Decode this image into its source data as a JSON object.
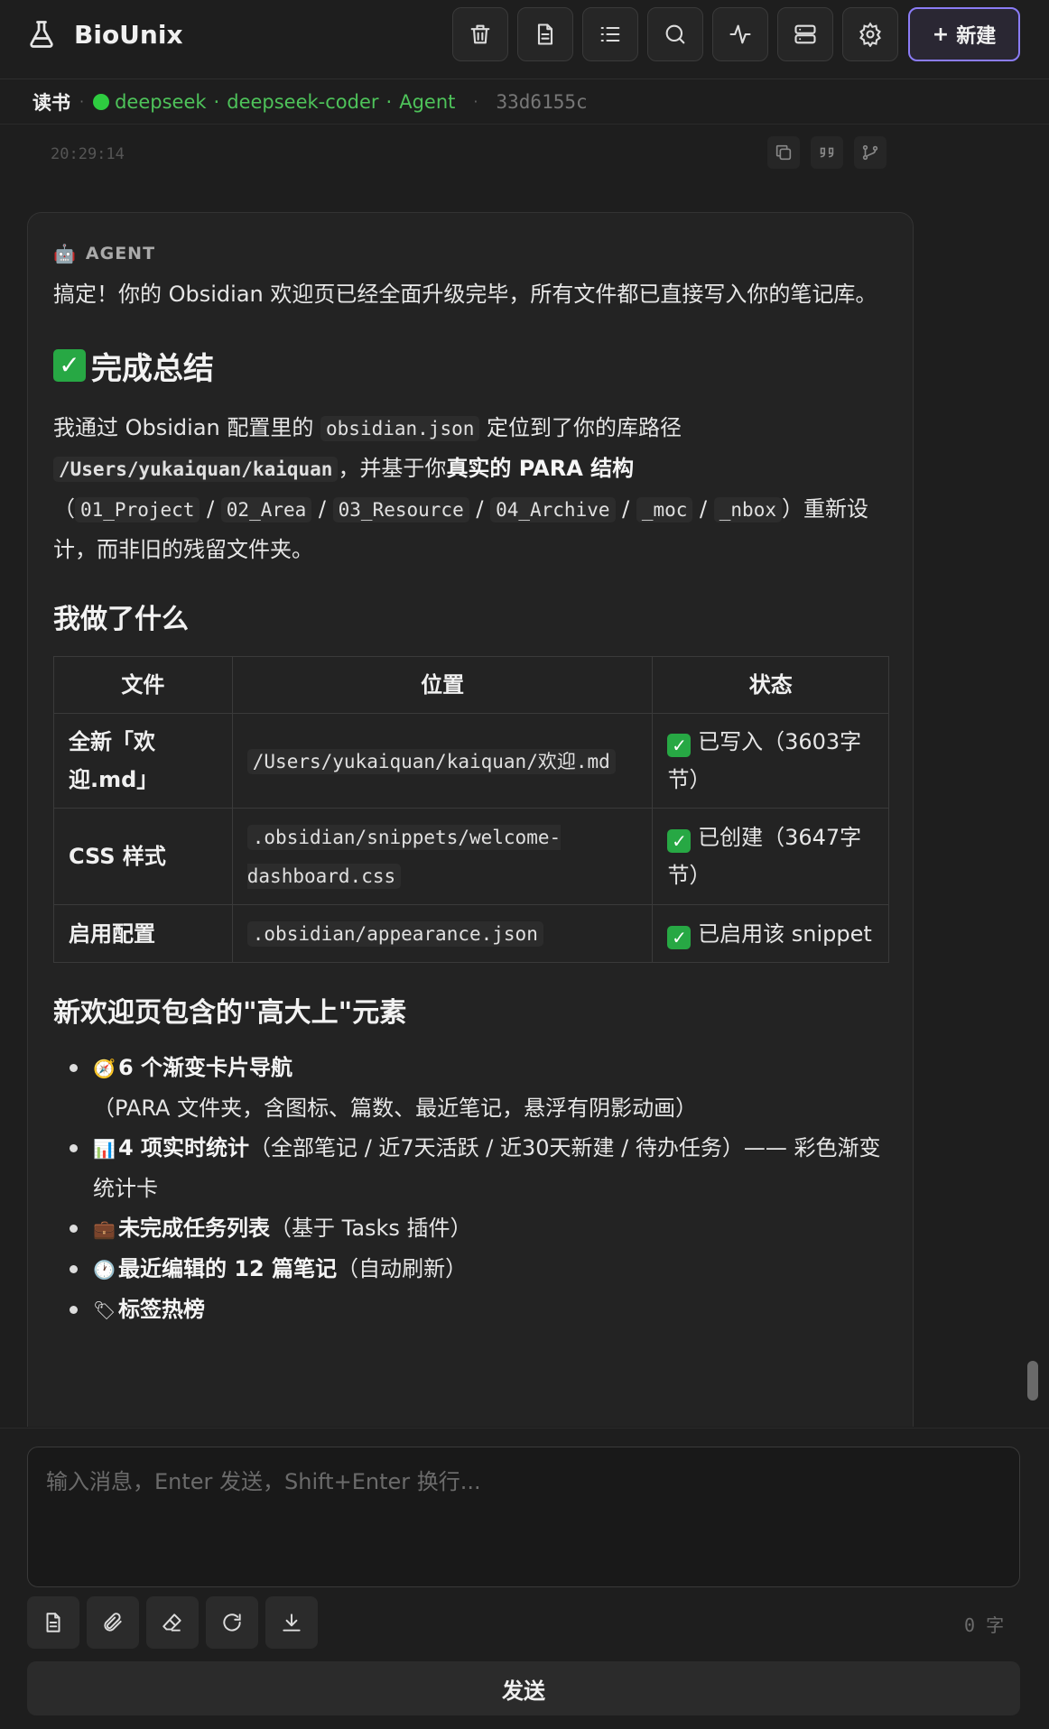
{
  "app": {
    "title": "BioUnix"
  },
  "toolbar": {
    "items": [
      "trash-icon",
      "document-icon",
      "list-icon",
      "search-icon",
      "activity-icon",
      "server-icon",
      "gear-icon"
    ],
    "new_label": "新建"
  },
  "session": {
    "title": "读书",
    "provider": "deepseek",
    "model": "deepseek-coder",
    "mode": "Agent",
    "hash": "33d6155c"
  },
  "message": {
    "timestamp": "20:29:14",
    "role": "AGENT",
    "intro": "搞定！你的 Obsidian 欢迎页已经全面升级完毕，所有文件都已直接写入你的笔记库。",
    "summary_heading": "完成总结",
    "summary": {
      "t1": "我通过 Obsidian 配置里的 ",
      "code1": "obsidian.json",
      "t2": " 定位到了你的库路径",
      "code2": "/Users/yukaiquan/kaiquan",
      "t3": "，并基于你",
      "bold": "真实的 PARA 结构",
      "t4": "（",
      "folders": [
        "01_Project",
        "02_Area",
        "03_Resource",
        "04_Archive",
        "_moc",
        "_nbox"
      ],
      "slash": " / ",
      "t5": "）重新设计，而非旧的残留文件夹。"
    },
    "done_heading": "我做了什么",
    "table": {
      "headers": [
        "文件",
        "位置",
        "状态"
      ],
      "rows": [
        {
          "file": "全新「欢迎.md」",
          "path": "/Users/yukaiquan/kaiquan/欢迎.md",
          "status": "已写入（3603字节）"
        },
        {
          "file": "CSS 样式",
          "path": ".obsidian/snippets/welcome-dashboard.css",
          "status": "已创建（3647字节）"
        },
        {
          "file": "启用配置",
          "path": ".obsidian/appearance.json",
          "status": "已启用该 snippet"
        }
      ]
    },
    "elements_heading": "新欢迎页包含的\"高大上\"元素",
    "elements": [
      {
        "icon": "🧭",
        "bold": "6 个渐变卡片导航",
        "rest": "（PARA 文件夹，含图标、篇数、最近笔记，悬浮有阴影动画）"
      },
      {
        "icon": "📊",
        "bold": "4 项实时统计",
        "rest": "（全部笔记 / 近7天活跃 / 近30天新建 / 待办任务）—— 彩色渐变统计卡"
      },
      {
        "icon": "💼",
        "bold": "未完成任务列表",
        "rest": "（基于 Tasks 插件）"
      },
      {
        "icon": "🕐",
        "bold": "最近编辑的 12 篇笔记",
        "rest": "（自动刷新）"
      },
      {
        "icon": "🏷",
        "bold": "标签热榜",
        "rest": ""
      }
    ]
  },
  "composer": {
    "placeholder": "输入消息，Enter 发送，Shift+Enter 换行...",
    "char_count": "0 字",
    "send_label": "发送",
    "tools": [
      "document-icon",
      "paperclip-icon",
      "eraser-icon",
      "refresh-icon",
      "download-icon"
    ]
  },
  "colors": {
    "accent": "#8b7cf6",
    "green": "#4ec35a",
    "check": "#27a844"
  }
}
